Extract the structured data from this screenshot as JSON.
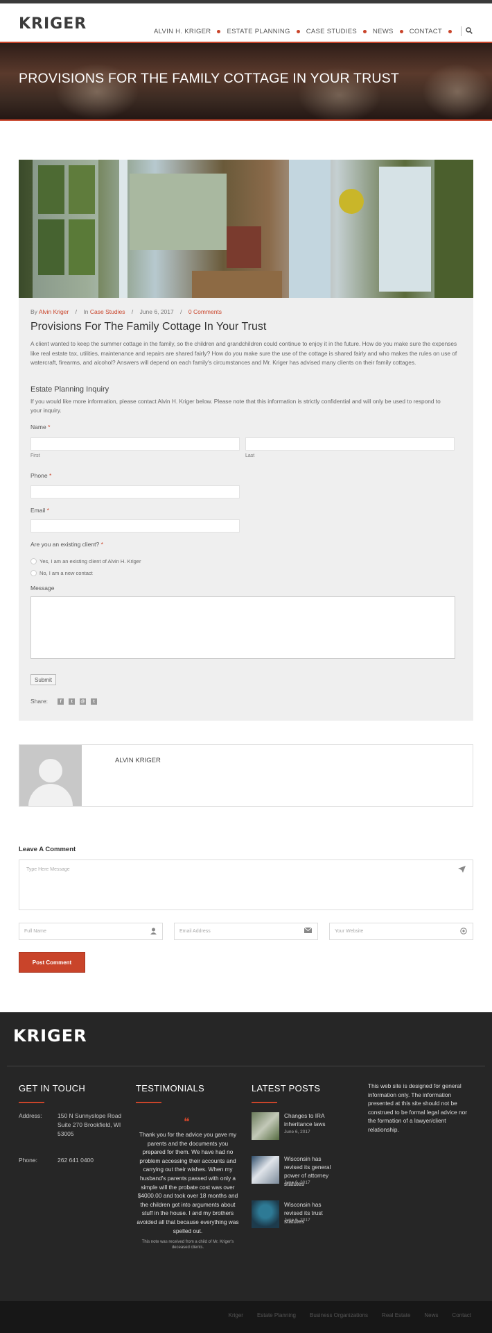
{
  "brand": {
    "logo": "KRIGER",
    "accent": "#c9442a"
  },
  "nav": {
    "items": [
      "ALVIN H. KRIGER",
      "ESTATE PLANNING",
      "CASE STUDIES",
      "NEWS",
      "CONTACT"
    ],
    "search_icon": "search-icon"
  },
  "hero": {
    "title": "PROVISIONS FOR THE FAMILY COTTAGE IN YOUR TRUST"
  },
  "post": {
    "meta": {
      "by": "By",
      "author": "Alvin Kriger",
      "in": "In",
      "category": "Case Studies",
      "date": "June 6, 2017",
      "comments": "0 Comments"
    },
    "title": "Provisions For The Family Cottage In Your Trust",
    "body": "A client wanted to keep the summer cottage in the family, so the children and grandchildren could continue to enjoy it in the future. How do you make sure the expenses like real estate tax, utilities, maintenance and repairs are shared fairly? How do you make sure the use of the cottage is shared fairly and who makes the rules on use of watercraft, firearms, and alcohol? Answers will depend on each family's circumstances and Mr. Kriger has advised many clients on their family cottages."
  },
  "form": {
    "title": "Estate Planning Inquiry",
    "intro": "If you would like more information, please contact Alvin H. Kriger below. Please note that this information is strictly confidential and will only be used to respond to your inquiry.",
    "name_label": "Name",
    "first_label": "First",
    "last_label": "Last",
    "phone_label": "Phone",
    "email_label": "Email",
    "client_label": "Are you an existing client?",
    "required_mark": "*",
    "options": [
      "Yes, I am an existing client of Alvin H. Kriger",
      "No, I am a new contact"
    ],
    "message_label": "Message",
    "submit_label": "Submit"
  },
  "share": {
    "label": "Share:",
    "icons": [
      "f",
      "t",
      "@",
      "t"
    ]
  },
  "author_box": {
    "name": "ALVIN KRIGER"
  },
  "comment": {
    "title": "Leave A Comment",
    "message_placeholder": "Type Here Message",
    "name_placeholder": "Full Name",
    "email_placeholder": "Email Address",
    "website_placeholder": "Your Website",
    "button": "Post Comment"
  },
  "footer": {
    "logo": "KRIGER",
    "get_in_touch": {
      "title": "GET IN TOUCH",
      "address_label": "Address:",
      "address": "150 N Sunnyslope Road Suite 270 Brookfield, WI 53005",
      "phone_label": "Phone:",
      "phone": "262 641 0400"
    },
    "testimonials": {
      "title": "TESTIMONIALS",
      "quote_mark": "❝",
      "text": "Thank you for the advice you gave my parents and the documents you prepared for them. We have had no problem accessing their accounts and carrying out their wishes. When my husband's parents passed with only a simple will the probate cost was over $4000.00 and took over 18 months and the children got into arguments about stuff in the house. I and my brothers avoided all that because everything was spelled out.",
      "note": "This note was received from a child of Mr. Kriger's deceased clients."
    },
    "latest_posts": {
      "title": "LATEST POSTS",
      "posts": [
        {
          "title": "Changes to IRA inheritance laws",
          "date": "June 6, 2017"
        },
        {
          "title": "Wisconsin has revised its general power of attorney statutes",
          "date": "June 6, 2017"
        },
        {
          "title": "Wisconsin has revised its trust statutes",
          "date": "June 6, 2017"
        }
      ]
    },
    "disclaimer": "This web site is designed for general information only. The information presented at this site should not be construed to be formal legal advice nor the formation of a lawyer/client relationship."
  },
  "bottom_bar": {
    "links": [
      "Kriger",
      "Estate Planning",
      "Business Organizations",
      "Real Estate",
      "News",
      "Contact"
    ]
  }
}
